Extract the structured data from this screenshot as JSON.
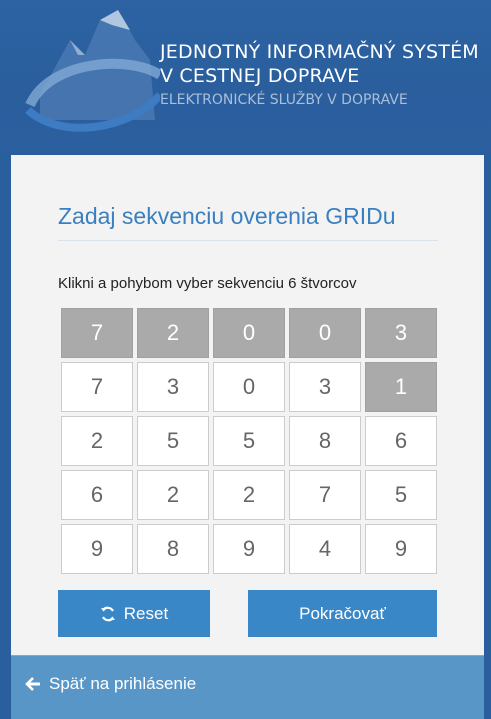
{
  "header": {
    "line1": "JEDNOTNÝ INFORMAČNÝ SYSTÉM",
    "line2": "V CESTNEJ DOPRAVE",
    "line3": "ELEKTRONICKÉ SLUŽBY V DOPRAVE",
    "logo_icon": "mountain-swoosh-logo-icon"
  },
  "card": {
    "title": "Zadaj sekvenciu overenia GRIDu",
    "instruction": "Klikni a pohybom vyber sekvenciu 6 štvorcov"
  },
  "grid": {
    "rows": [
      [
        "7",
        "2",
        "0",
        "0",
        "3"
      ],
      [
        "7",
        "3",
        "0",
        "3",
        "1"
      ],
      [
        "2",
        "5",
        "5",
        "8",
        "6"
      ],
      [
        "6",
        "2",
        "2",
        "7",
        "5"
      ],
      [
        "9",
        "8",
        "9",
        "4",
        "9"
      ]
    ],
    "selected": [
      [
        0,
        0
      ],
      [
        0,
        1
      ],
      [
        0,
        2
      ],
      [
        0,
        3
      ],
      [
        0,
        4
      ],
      [
        1,
        4
      ]
    ]
  },
  "buttons": {
    "reset_label": "Reset",
    "reset_icon": "refresh-icon",
    "continue_label": "Pokračovať"
  },
  "footer": {
    "back_label": "Späť na prihlásenie",
    "back_icon": "arrow-left-icon"
  },
  "colors": {
    "header_bg": "#2a5f9e",
    "title": "#3a7fbf",
    "button": "#3a87c8",
    "footer": "#5996c8",
    "selected_cell": "#aaaaaa"
  }
}
